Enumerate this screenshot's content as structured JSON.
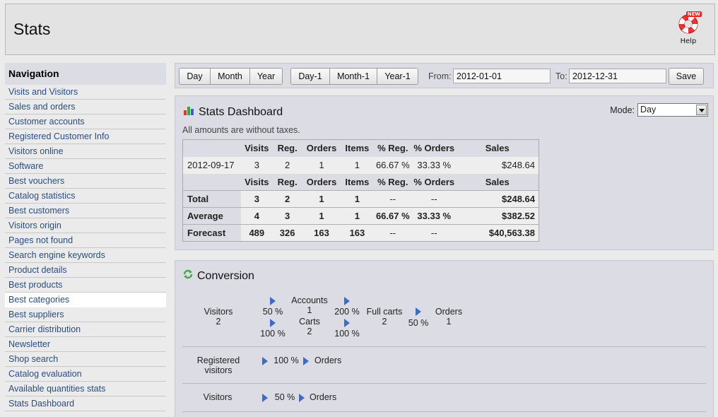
{
  "header": {
    "title": "Stats",
    "help_label": "Help",
    "help_badge": "NEW"
  },
  "navigation": {
    "title": "Navigation",
    "items": [
      "Visits and Visitors",
      "Sales and orders",
      "Customer accounts",
      "Registered Customer Info",
      "Visitors online",
      "Software",
      "Best vouchers",
      "Catalog statistics",
      "Best customers",
      "Visitors origin",
      "Pages not found",
      "Search engine keywords",
      "Product details",
      "Best products",
      "Best categories",
      "Best suppliers",
      "Carrier distribution",
      "Newsletter",
      "Shop search",
      "Catalog evaluation",
      "Available quantities stats",
      "Stats Dashboard"
    ],
    "active": "Best categories"
  },
  "toolbar": {
    "day": "Day",
    "month": "Month",
    "year": "Year",
    "day1": "Day-1",
    "month1": "Month-1",
    "year1": "Year-1",
    "from_label": "From:",
    "from_value": "2012-01-01",
    "to_label": "To:",
    "to_value": "2012-12-31",
    "save": "Save"
  },
  "dashboard": {
    "title": "Stats Dashboard",
    "mode_label": "Mode:",
    "mode_value": "Day",
    "note": "All amounts are without taxes.",
    "columns": [
      "Visits",
      "Reg.",
      "Orders",
      "Items",
      "% Reg.",
      "% Orders",
      "Sales"
    ],
    "rows": [
      {
        "date": "2012-09-17",
        "visits": "3",
        "reg": "2",
        "orders": "1",
        "items": "1",
        "preg": "66.67 %",
        "porders": "33.33 %",
        "sales": "$248.64"
      }
    ],
    "summary": [
      {
        "label": "Total",
        "visits": "3",
        "reg": "2",
        "orders": "1",
        "items": "1",
        "preg": "--",
        "porders": "--",
        "sales": "$248.64"
      },
      {
        "label": "Average",
        "visits": "4",
        "reg": "3",
        "orders": "1",
        "items": "1",
        "preg": "66.67 %",
        "porders": "33.33 %",
        "sales": "$382.52"
      },
      {
        "label": "Forecast",
        "visits": "489",
        "reg": "326",
        "orders": "163",
        "items": "163",
        "preg": "--",
        "porders": "--",
        "sales": "$40,563.38"
      }
    ]
  },
  "conversion": {
    "title": "Conversion",
    "funnel": {
      "visitors_label": "Visitors",
      "visitors_value": "2",
      "to_accounts_pct": "50 %",
      "accounts_label": "Accounts",
      "accounts_value": "1",
      "accounts_to_full_pct": "200 %",
      "to_carts_pct": "100 %",
      "carts_label": "Carts",
      "carts_value": "2",
      "carts_to_full_pct": "100 %",
      "full_carts_label": "Full carts",
      "full_carts_value": "2",
      "full_to_orders_pct": "50 %",
      "orders_label": "Orders",
      "orders_value": "1"
    },
    "registered": {
      "label": "Registered visitors",
      "pct": "100 %",
      "target": "Orders"
    },
    "visitors": {
      "label": "Visitors",
      "pct": "50 %",
      "target": "Orders"
    }
  },
  "colors": {
    "link": "#2a4d80",
    "panel_bg": "#dcdce4",
    "arrow": "#3d6cc4"
  }
}
